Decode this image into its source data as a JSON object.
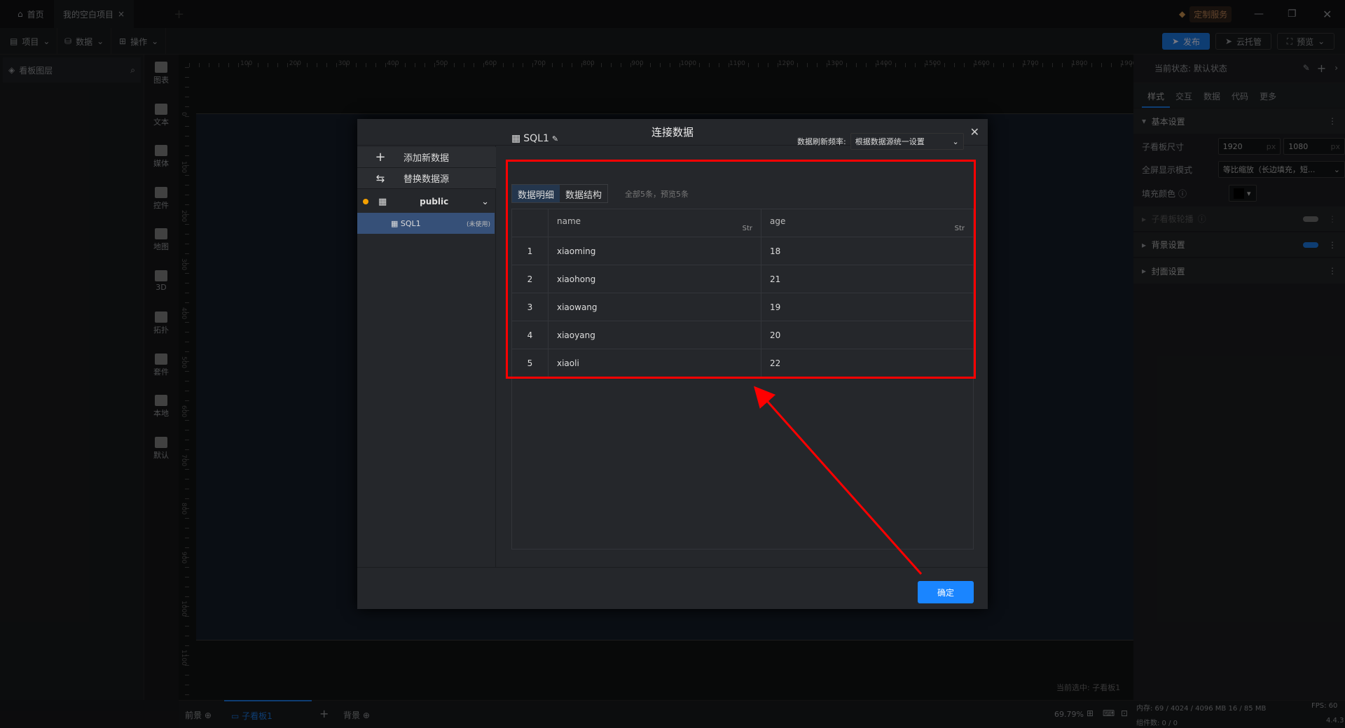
{
  "tabs": {
    "home": "首页",
    "project": "我的空白项目",
    "custom_service": "定制服务"
  },
  "toolbar": {
    "project": "项目",
    "data": "数据",
    "operate": "操作",
    "publish": "发布",
    "cloud": "云托管",
    "preview": "预览"
  },
  "layers": {
    "title": "看板图层"
  },
  "components": [
    "图表",
    "文本",
    "媒体",
    "控件",
    "地图",
    "3D",
    "拓扑",
    "套件",
    "本地",
    "默认"
  ],
  "ruler": {
    "h": [
      "100",
      "200",
      "300",
      "400",
      "500",
      "600",
      "700",
      "800",
      "900",
      "1000",
      "1100",
      "1200",
      "1300",
      "1400",
      "1500",
      "1600",
      "1700",
      "1800",
      "1900"
    ],
    "v": [
      "0",
      "100",
      "200",
      "300",
      "400",
      "500",
      "600",
      "700",
      "800",
      "900",
      "1000",
      "1100"
    ]
  },
  "canvas": {
    "selected": "当前选中: 子看板1"
  },
  "right": {
    "state": "当前状态: 默认状态",
    "tabs": [
      "样式",
      "交互",
      "数据",
      "代码",
      "更多"
    ],
    "basic": "基本设置",
    "size_label": "子看板尺寸",
    "width": "1920",
    "height": "1080",
    "unit": "px",
    "fullscreen_label": "全屏显示模式",
    "fullscreen_value": "等比缩放（长边填充，短...",
    "fill_label": "填充颜色",
    "fill_color": "#000000",
    "carousel": "子看板轮播",
    "background": "背景设置",
    "cover": "封面设置"
  },
  "bottom": {
    "front": "前景",
    "board": "子看板1",
    "back": "背景",
    "zoom": "69.79%",
    "memory": "内存: 69 / 4024 / 4096 MB  16 / 85 MB",
    "fps": "FPS: 60",
    "count": "组件数: 0 / 0",
    "version": "4.4.3"
  },
  "dialog": {
    "title": "连接数据",
    "add": "添加新数据",
    "replace": "替换数据源",
    "schema": "public",
    "source": "SQL1",
    "source_status": "(未使用)",
    "name": "SQL1",
    "refresh_label": "数据刷新频率:",
    "refresh_value": "根据数据源统一设置",
    "tab_detail": "数据明细",
    "tab_struct": "数据结构",
    "summary": "全部5条，预览5条",
    "columns": [
      {
        "name": "name",
        "type": "Str"
      },
      {
        "name": "age",
        "type": "Str"
      }
    ],
    "rows": [
      [
        "1",
        "xiaoming",
        "18"
      ],
      [
        "2",
        "xiaohong",
        "21"
      ],
      [
        "3",
        "xiaowang",
        "19"
      ],
      [
        "4",
        "xiaoyang",
        "20"
      ],
      [
        "5",
        "xiaoli",
        "22"
      ]
    ],
    "confirm": "确定"
  },
  "colors": {
    "accent": "#1677ff",
    "highlight": "#ff0000"
  }
}
